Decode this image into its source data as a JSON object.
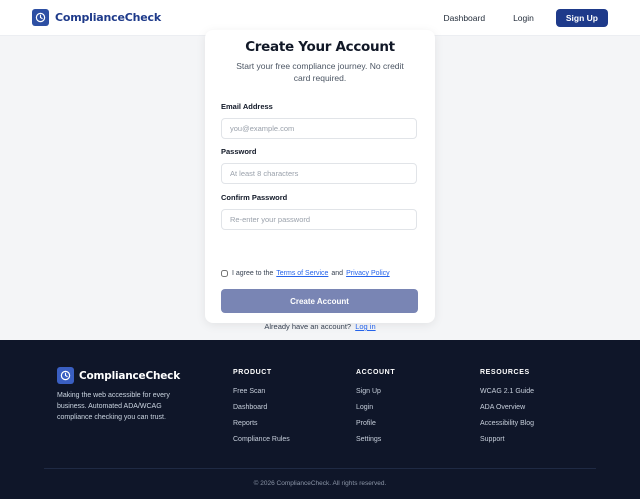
{
  "brand": {
    "name": "ComplianceCheck",
    "logo_icon": "clock-icon",
    "color": "#1e3a8a"
  },
  "nav": {
    "dashboard": "Dashboard",
    "login": "Login",
    "signup": "Sign Up"
  },
  "form": {
    "title": "Create Your Account",
    "subtitle": "Start your free compliance journey. No credit card required.",
    "email": {
      "label": "Email Address",
      "placeholder": "you@example.com",
      "value": ""
    },
    "password": {
      "label": "Password",
      "placeholder": "At least 8 characters",
      "value": ""
    },
    "confirm": {
      "label": "Confirm Password",
      "placeholder": "Re-enter your password",
      "value": ""
    },
    "agree": {
      "prefix": "I agree to the",
      "terms": "Terms of Service",
      "and": "and",
      "privacy": "Privacy Policy",
      "checked": false
    },
    "submit": "Create Account",
    "login_prompt": "Already have an account?",
    "login_link": "Log in"
  },
  "footer": {
    "brand": "ComplianceCheck",
    "description": "Making the web accessible for every business. Automated ADA/WCAG compliance checking you can trust.",
    "columns": [
      {
        "title": "PRODUCT",
        "links": [
          "Free Scan",
          "Dashboard",
          "Reports",
          "Compliance Rules"
        ]
      },
      {
        "title": "ACCOUNT",
        "links": [
          "Sign Up",
          "Login",
          "Profile",
          "Settings"
        ]
      },
      {
        "title": "RESOURCES",
        "links": [
          "WCAG 2.1 Guide",
          "ADA Overview",
          "Accessibility Blog",
          "Support"
        ]
      }
    ],
    "copyright": "© 2026 ComplianceCheck. All rights reserved."
  },
  "colors": {
    "primary": "#1e3a8a",
    "button_disabled": "#7985b4",
    "footer_bg": "#0f1629",
    "link": "#2563eb"
  }
}
